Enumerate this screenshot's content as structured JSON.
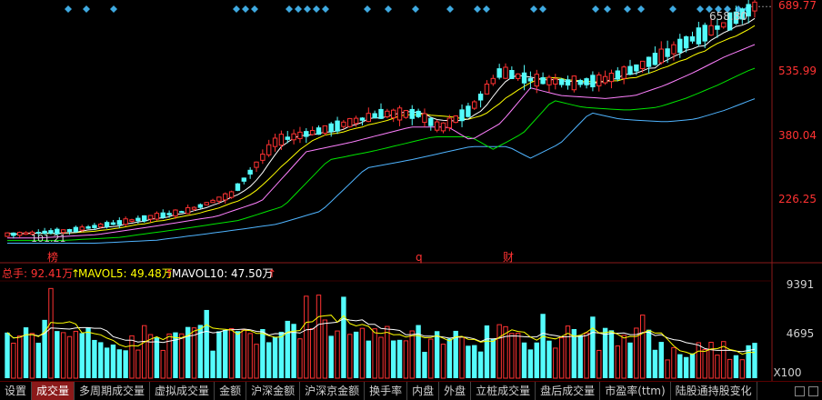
{
  "price_axis": {
    "labels": [
      "689.77",
      "535.99",
      "380.04",
      "226.25"
    ],
    "last_price": "658.80",
    "low_mark": "101.21"
  },
  "event_markers": [
    "榜",
    "q",
    "财"
  ],
  "volume_legend": {
    "total": "总手: 92.41万",
    "mavol5": "MAVOL5: 49.48万",
    "mavol10": "MAVOL10: 47.50万"
  },
  "volume_axis": {
    "labels": [
      "9391",
      "4695",
      "X100"
    ]
  },
  "tabs": [
    "设置",
    "成交量",
    "多周期成交量",
    "虚拟成交量",
    "金额",
    "沪深金额",
    "沪深京金额",
    "换手率",
    "内盘",
    "外盘",
    "立桩成交量",
    "盘后成交量",
    "市盈率(ttm)",
    "陆股通持股变化"
  ],
  "active_tab": "成交量",
  "colors": {
    "up": "#ff3232",
    "down": "#54fcfc",
    "ma5": "#ffffff",
    "ma10": "#ffff00",
    "ma20": "#ff80ff",
    "ma30": "#00e600",
    "ma60": "#4fb4ff",
    "axis_text": "#ff3232",
    "diamond": "#3fa9e0"
  },
  "chart_data": {
    "type": "candlestick",
    "price_range": [
      100,
      690
    ],
    "volume_range": [
      0,
      9391
    ],
    "volume_unit": "X100",
    "candles_count": 121,
    "series": [
      "MA5",
      "MA10",
      "MA20",
      "MA30",
      "MA60"
    ]
  }
}
